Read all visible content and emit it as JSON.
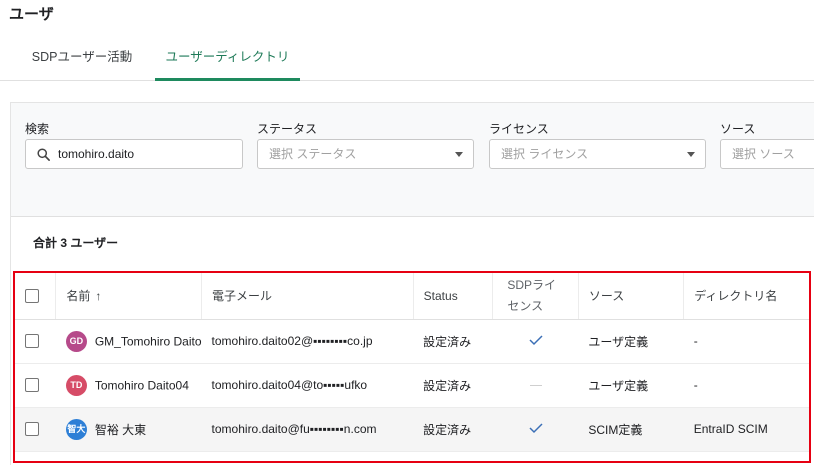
{
  "page": {
    "title": "ユーザ"
  },
  "tabs": [
    {
      "label": "SDPユーザー活動",
      "active": false
    },
    {
      "label": "ユーザーディレクトリ",
      "active": true
    }
  ],
  "filters": {
    "search": {
      "label": "検索",
      "value": "tomohiro.daito"
    },
    "status": {
      "label": "ステータス",
      "placeholder": "選択 ステータス"
    },
    "license": {
      "label": "ライセンス",
      "placeholder": "選択 ライセンス"
    },
    "source": {
      "label": "ソース",
      "placeholder": "選択 ソース"
    }
  },
  "summary": {
    "total": "合計 3 ユーザー"
  },
  "table": {
    "headers": {
      "name": "名前",
      "email": "電子メール",
      "status": "Status",
      "sdp_line1": "SDPライ",
      "sdp_line2": "センス",
      "source": "ソース",
      "directory": "ディレクトリ名"
    },
    "rows": [
      {
        "initials": "GD",
        "avatar_color": "#b64a8a",
        "name": "GM_Tomohiro Daito",
        "email": "tomohiro.daito02@▪▪▪▪▪▪▪▪co.jp",
        "status": "設定済み",
        "license": "check",
        "source": "ユーザ定義",
        "directory": "-"
      },
      {
        "initials": "TD",
        "avatar_color": "#d64c67",
        "name": "Tomohiro Daito04",
        "email": "tomohiro.daito04@to▪▪▪▪▪ufko",
        "status": "設定済み",
        "license": "none",
        "source": "ユーザ定義",
        "directory": "-"
      },
      {
        "initials": "智大",
        "avatar_color": "#2d7fd6",
        "name": "智裕 大東",
        "email": "tomohiro.daito@fu▪▪▪▪▪▪▪▪n.com",
        "status": "設定済み",
        "license": "check",
        "source": "SCIM定義",
        "directory": "EntraID SCIM"
      }
    ]
  },
  "colors": {
    "accent": "#1e8a5e",
    "highlight_border": "#e60012",
    "check": "#3b6fb6"
  },
  "icons": {
    "search": "search-icon",
    "sort": "sort-ascending-icon",
    "dropdown": "chevron-down-icon",
    "check": "check-icon"
  }
}
